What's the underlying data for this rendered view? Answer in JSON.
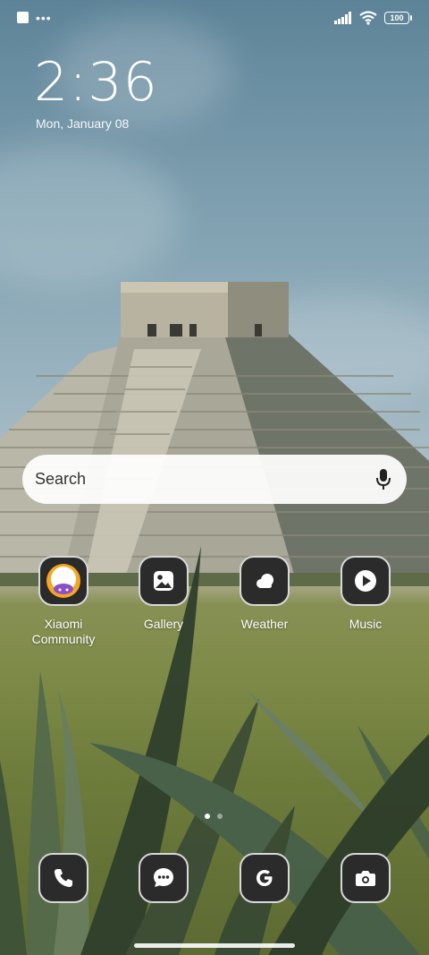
{
  "status_bar": {
    "battery": "100"
  },
  "clock": {
    "time": "2:36",
    "date": "Mon, January 08"
  },
  "search": {
    "placeholder": "Search"
  },
  "apps": [
    {
      "label": "Xiaomi\nCommunity",
      "icon": "xiaomi-community-icon"
    },
    {
      "label": "Gallery",
      "icon": "gallery-icon"
    },
    {
      "label": "Weather",
      "icon": "weather-icon"
    },
    {
      "label": "Music",
      "icon": "music-icon"
    }
  ],
  "dock": [
    {
      "icon": "phone-icon"
    },
    {
      "icon": "messages-icon"
    },
    {
      "icon": "google-icon"
    },
    {
      "icon": "camera-icon"
    }
  ],
  "pager": {
    "pages": 2,
    "current": 1
  },
  "colors": {
    "icon_bg": "#2b2b2b",
    "icon_border": "#d8d8d8",
    "search_bg": "#ffffff"
  }
}
